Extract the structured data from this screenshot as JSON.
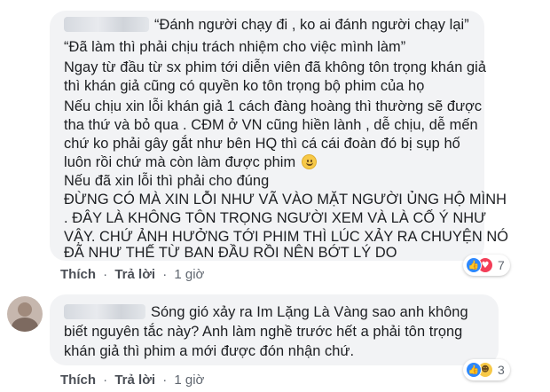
{
  "comments": [
    {
      "lines": [
        "“Đánh người chạy đi , ko ai đánh người chạy lại”",
        "“Đã làm thì phải chịu trách nhiệm cho việc mình làm”",
        "Ngay từ đầu từ sx phim tới diễn viên đã không tôn trọng khán giả",
        "thì khán giả cũng có quyền ko tôn trọng bộ phim của họ",
        "Nếu chịu xin lỗi khán giả 1 cách đàng hoàng thì thường sẽ được",
        "tha thứ và bỏ qua . CĐM ở VN cũng hiền lành , dễ chịu, dễ mến",
        "chứ ko phải gây gắt như bên HQ thì cá cái đoàn đó bị sụp hố",
        "luôn rồi chứ mà còn làm được phim",
        "Nếu đã xin lỗi thì phải cho đúng",
        "ĐỪNG CÓ MÀ XIN LỖI NHƯ VÃ VÀO MẶT NGƯỜI ỦNG HỘ MÌNH",
        ". ĐÂY LÀ KHÔNG TÔN TRỌNG NGƯỜI XEM VÀ LÀ CỐ Ý NHƯ",
        "VẬY. CHỨ ẢNH HƯỞNG TỚI PHIM THÌ LÚC XẢY RA CHUYỆN NÓ",
        "ĐÃ NHƯ THẾ TỪ BAN ĐẦU RỒI NÊN BỚT LÝ DO"
      ],
      "emoji": "slightly-smiling-face-icon",
      "actions": {
        "like": "Thích",
        "reply": "Trả lời",
        "time": "1 giờ"
      },
      "reactions": {
        "icons": [
          "like-icon",
          "love-icon"
        ],
        "count": "7"
      }
    },
    {
      "lines": [
        "Sóng gió xảy ra Im Lặng Là Vàng sao anh không",
        "biết nguyên tắc này? Anh làm nghề trước hết a phải tôn trọng",
        "khán giả thì phim a mới được đón nhận chứ."
      ],
      "actions": {
        "like": "Thích",
        "reply": "Trả lời",
        "time": "1 giờ"
      },
      "reactions": {
        "icons": [
          "like-icon",
          "haha-icon"
        ],
        "count": "3"
      }
    }
  ],
  "colors": {
    "bubble": "#f2f3f5",
    "text": "#1c1e21",
    "meta": "#606770",
    "like": "#2d88ff",
    "love": "#f33e58",
    "haha": "#f7c948"
  }
}
